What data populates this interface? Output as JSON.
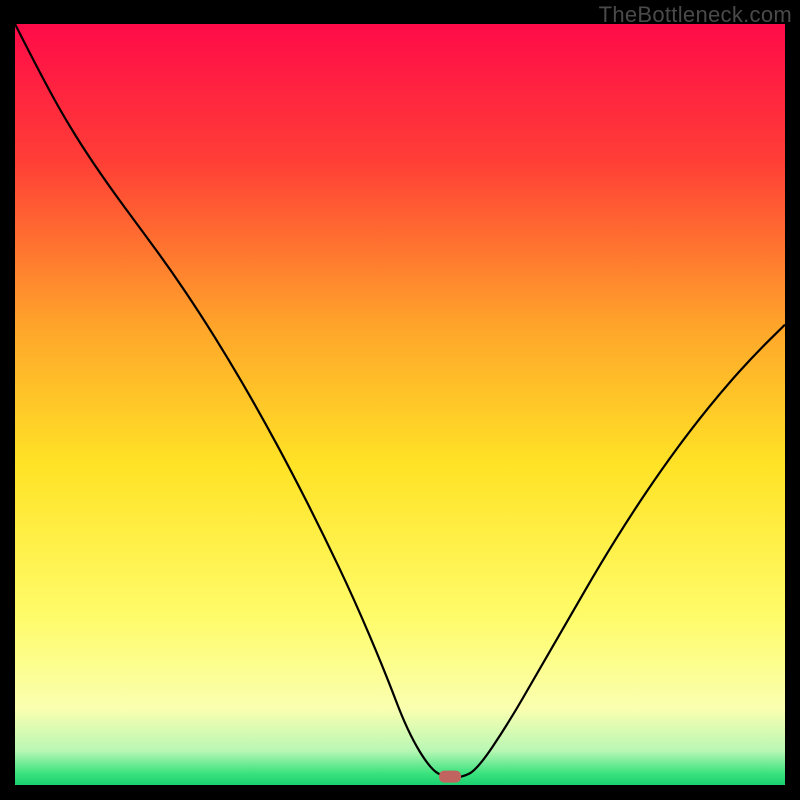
{
  "watermark": "TheBottleneck.com",
  "colors": {
    "frame": "#000000",
    "curve_stroke": "#000000",
    "marker_fill": "#c1645f",
    "watermark_text": "#4a4a4a"
  },
  "chart_data": {
    "type": "line",
    "title": "",
    "xlabel": "",
    "ylabel": "",
    "xlim": [
      0,
      100
    ],
    "ylim": [
      0,
      100
    ],
    "grid": false,
    "legend": false,
    "background_gradient": {
      "direction": "vertical",
      "stops": [
        {
          "offset": 0.0,
          "color": "#ff0b49"
        },
        {
          "offset": 0.18,
          "color": "#ff3e36"
        },
        {
          "offset": 0.4,
          "color": "#ffa62a"
        },
        {
          "offset": 0.58,
          "color": "#ffe326"
        },
        {
          "offset": 0.78,
          "color": "#fffc6a"
        },
        {
          "offset": 0.9,
          "color": "#faffb0"
        },
        {
          "offset": 0.955,
          "color": "#b8f7b4"
        },
        {
          "offset": 0.985,
          "color": "#3ae27e"
        },
        {
          "offset": 1.0,
          "color": "#19cf6f"
        }
      ]
    },
    "series": [
      {
        "name": "bottleneck-curve",
        "x": [
          0,
          4,
          8,
          12,
          16,
          20,
          24,
          28,
          32,
          36,
          40,
          44,
          48,
          51,
          54,
          56,
          58,
          60,
          64,
          68,
          72,
          76,
          80,
          84,
          88,
          92,
          96,
          100
        ],
        "y": [
          100,
          92,
          85,
          79,
          73.5,
          68,
          62,
          55.5,
          48.5,
          41,
          33,
          24.5,
          15,
          7,
          2,
          1,
          1,
          2,
          8,
          15,
          22,
          29,
          35.5,
          41.5,
          47,
          52,
          56.5,
          60.5
        ]
      }
    ],
    "marker": {
      "name": "optimum-marker",
      "x": 56.5,
      "y": 1.1,
      "shape": "rounded-rect",
      "fill": "#c1645f"
    }
  }
}
